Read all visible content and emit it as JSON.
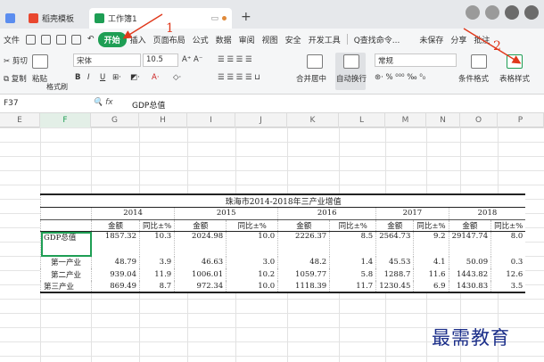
{
  "tabs": {
    "tab1_label": "稻壳模板",
    "tab2_label": "工作簿1"
  },
  "menu": {
    "file": "文件",
    "start": "开始",
    "insert": "插入",
    "page_layout": "页面布局",
    "formula": "公式",
    "data": "数据",
    "review": "审阅",
    "view": "视图",
    "security": "安全",
    "dev_tools": "开发工具",
    "search_cmd": "Q查找命令...",
    "unsaved": "未保存",
    "share": "分享",
    "comment": "批注"
  },
  "ribbon": {
    "cut": "剪切",
    "paste": "粘贴",
    "copy": "复制",
    "format_painter": "格式刷",
    "font_name": "宋体",
    "font_size": "10.5",
    "merge_center": "合并居中",
    "auto_wrap": "自动换行",
    "number_format": "常规",
    "cond_format": "条件格式",
    "table_style": "表格样式"
  },
  "formula_bar": {
    "cell_ref": "F37",
    "fx": "fx",
    "value": "GDP总值"
  },
  "columns": [
    "E",
    "F",
    "G",
    "H",
    "I",
    "J",
    "K",
    "L",
    "M",
    "N",
    "O",
    "P"
  ],
  "table": {
    "title": "珠海市2014-2018年三产业增值",
    "years": [
      "2014",
      "2015",
      "2016",
      "2017",
      "2018"
    ],
    "sub_headers": [
      "金额",
      "同比±%",
      "金额",
      "同比±%",
      "金额",
      "同比±%",
      "金额",
      "同比±%",
      "金额",
      "同比±%"
    ],
    "rows": [
      {
        "label": "GDP总值",
        "values": [
          "1857.32",
          "10.3",
          "2024.98",
          "10.0",
          "2226.37",
          "8.5",
          "2564.73",
          "9.2",
          "29147.74",
          "8.0"
        ]
      },
      {
        "label": "第一产业",
        "values": [
          "48.79",
          "3.9",
          "46.63",
          "3.0",
          "48.2",
          "1.4",
          "45.53",
          "4.1",
          "50.09",
          "0.3"
        ]
      },
      {
        "label": "第二产业",
        "values": [
          "939.04",
          "11.9",
          "1006.01",
          "10.2",
          "1059.77",
          "5.8",
          "1288.7",
          "11.6",
          "1443.82",
          "12.6"
        ]
      },
      {
        "label": "第三产业",
        "values": [
          "869.49",
          "8.7",
          "972.34",
          "10.0",
          "1118.39",
          "11.7",
          "1230.45",
          "6.9",
          "1430.83",
          "3.5"
        ]
      }
    ]
  },
  "annotations": {
    "step1": "1",
    "step2": "2",
    "watermark": "最需教育"
  },
  "colors": {
    "accent": "#1e9e54",
    "annotation": "#e0391c",
    "watermark": "#1c2f8a"
  }
}
